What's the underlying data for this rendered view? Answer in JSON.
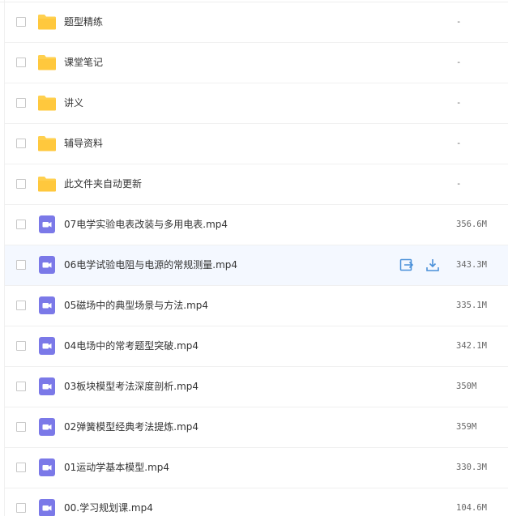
{
  "files": [
    {
      "name": "题型精练",
      "size": "-",
      "type": "folder"
    },
    {
      "name": "课堂笔记",
      "size": "-",
      "type": "folder"
    },
    {
      "name": "讲义",
      "size": "-",
      "type": "folder"
    },
    {
      "name": "辅导资料",
      "size": "-",
      "type": "folder"
    },
    {
      "name": "此文件夹自动更新",
      "size": "-",
      "type": "folder"
    },
    {
      "name": "07电学实验电表改装与多用电表.mp4",
      "size": "356.6M",
      "type": "video"
    },
    {
      "name": "06电学试验电阻与电源的常规测量.mp4",
      "size": "343.3M",
      "type": "video"
    },
    {
      "name": "05磁场中的典型场景与方法.mp4",
      "size": "335.1M",
      "type": "video"
    },
    {
      "name": "04电场中的常考题型突破.mp4",
      "size": "342.1M",
      "type": "video"
    },
    {
      "name": "03板块模型考法深度剖析.mp4",
      "size": "350M",
      "type": "video"
    },
    {
      "name": "02弹簧模型经典考法提炼.mp4",
      "size": "359M",
      "type": "video"
    },
    {
      "name": "01运动学基本模型.mp4",
      "size": "330.3M",
      "type": "video"
    },
    {
      "name": "00.学习规划课.mp4",
      "size": "104.6M",
      "type": "video"
    }
  ],
  "icons": {
    "folder": "folder-icon",
    "video": "video-file-icon",
    "share": "share-icon",
    "download": "download-icon"
  },
  "colors": {
    "folder": "#FFD04F",
    "video": "#7B79E8",
    "action": "#4A90D9",
    "hover_row": "#F4F8FF"
  }
}
